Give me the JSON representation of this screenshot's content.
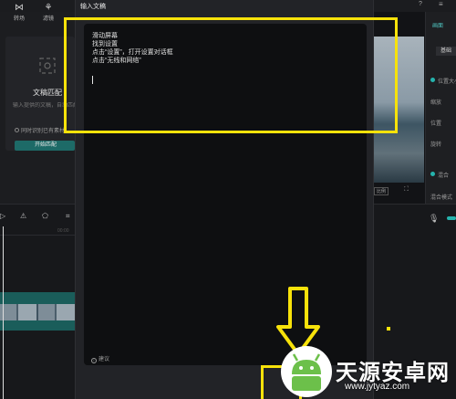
{
  "app": {
    "left_panel": {
      "tools": [
        {
          "label": "转场",
          "icon": "transition-icon"
        },
        {
          "label": "滤镜",
          "icon": "filter-icon"
        }
      ],
      "card_title": "文稿匹配",
      "card_desc": "输入提供的文稿，自动匹配素材",
      "checkbox_label": "同时识别已有素材",
      "button_label": "开始匹配"
    },
    "player": {
      "small_button": "比例",
      "fullscreen_icon": "fullscreen-icon"
    },
    "right_panel": {
      "tab_label": "画面",
      "button_label": "基础",
      "labels": [
        "位置大小",
        "缩放",
        "位置",
        "旋转",
        "混合",
        "混合模式"
      ]
    },
    "timeline": {
      "tick_label": "00:00",
      "mic_icon": "microphone-icon"
    }
  },
  "modal": {
    "title": "输入文稿",
    "script_lines": [
      "滑动屏幕",
      "找到设置",
      "点击“设置”，打开设置对话框",
      "点击“无线和网络”"
    ],
    "hint": "建议"
  },
  "annotations": {
    "highlight_color": "#f7e20a"
  },
  "watermark": {
    "title": "天源安卓网",
    "url": "www.jytyaz.com"
  }
}
